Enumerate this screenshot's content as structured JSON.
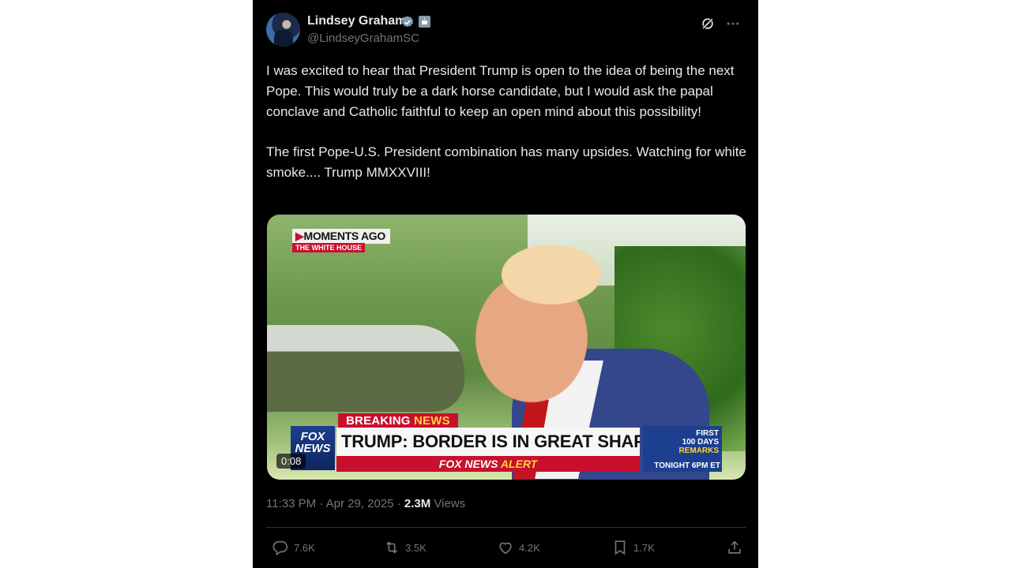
{
  "author": {
    "name": "Lindsey Graham",
    "handle": "@LindseyGrahamSC",
    "verified_icon": "verified-badge-icon",
    "affiliation_icon": "government-badge-icon"
  },
  "header_icons": [
    "grok-icon",
    "more-icon"
  ],
  "tweet": {
    "paragraph1": "I was excited to hear that President Trump is open to the idea of being the next Pope. This would truly be a dark horse candidate, but I would ask the papal conclave and Catholic faithful to keep an open mind about this possibility!",
    "paragraph2": "The first Pope-U.S. President combination has many upsides. Watching for white smoke.... Trump MMXXVIII!"
  },
  "video": {
    "moments_ago": "MOMENTS AGO",
    "location": "THE WHITE HOUSE",
    "breaking": "BREAKING",
    "breaking_news": "NEWS",
    "logo_line1": "FOX",
    "logo_line2": "NEWS",
    "headline": "TRUMP: BORDER IS IN GREAT SHAPE",
    "alert_prefix": "FOX NEWS",
    "alert_word": "ALERT",
    "promo_line1": "FIRST",
    "promo_line2": "100 DAYS",
    "promo_line3": "REMARKS",
    "promo_time": "TONIGHT 6PM ET",
    "duration": "0:08"
  },
  "meta": {
    "time": "11:33 PM",
    "date": "Apr 29, 2025",
    "separator": " · ",
    "views_count": "2.3M",
    "views_label": "Views"
  },
  "actions": {
    "replies": "7.6K",
    "reposts": "3.5K",
    "likes": "4.2K",
    "bookmarks": "1.7K"
  }
}
